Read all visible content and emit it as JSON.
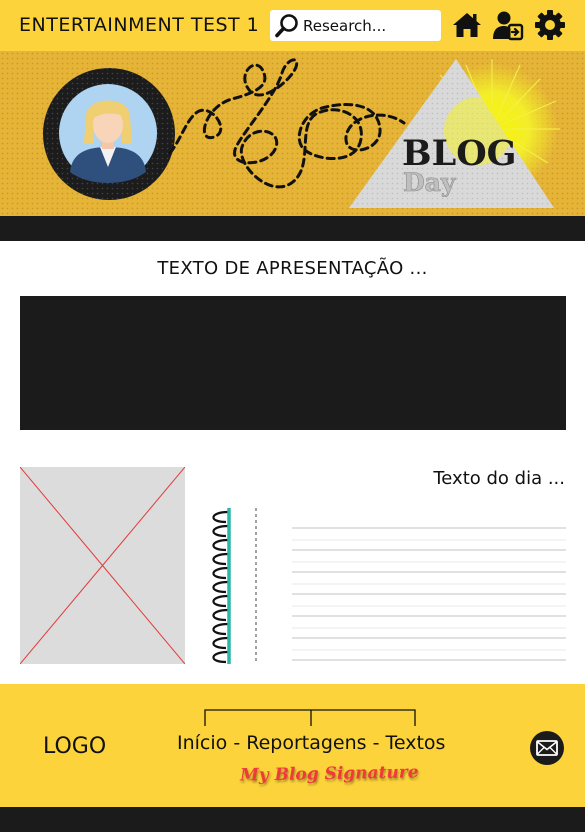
{
  "header": {
    "title": "ENTERTAINMENT TEST 1",
    "search": {
      "placeholder": "Research..."
    },
    "icons": [
      "home-icon",
      "user-login-icon",
      "gear-icon"
    ]
  },
  "banner": {
    "blog_word": "BLOG",
    "day_word": "Day",
    "avatar": "avatar-woman-icon"
  },
  "main": {
    "intro_text": "TEXTO DE APRESENTAÇÃO ...",
    "day_text": "Texto do dia ..."
  },
  "footer": {
    "logo": "LOGO",
    "nav": {
      "inicio": "Início",
      "sep1": " - ",
      "reportagens": "Reportagens",
      "sep2": " - ",
      "textos": "Textos"
    },
    "signature": "My Blog Signature",
    "mail_icon": "mail-icon"
  },
  "colors": {
    "accent_yellow": "#fcd33a",
    "banner_yellow": "#e6b437",
    "dark": "#1b1b1b",
    "signature_red": "#f03a3a"
  }
}
